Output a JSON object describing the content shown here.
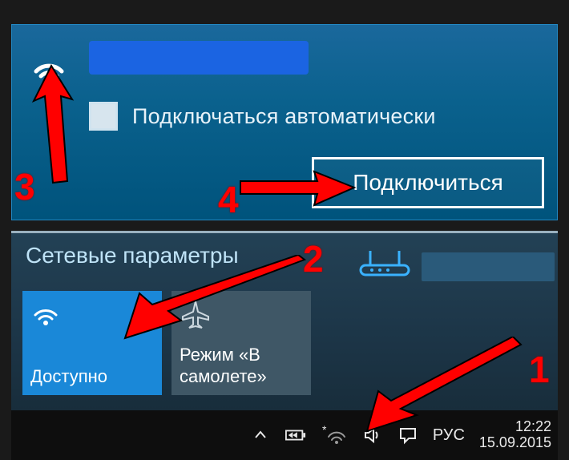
{
  "top": {
    "auto_connect_label": "Подключаться автоматически",
    "connect_button": "Подключиться"
  },
  "bottom": {
    "section_title": "Сетевые параметры",
    "tile_wifi_label": "Доступно",
    "tile_plane_label": "Режим «В самолете»"
  },
  "taskbar": {
    "lang": "РУС",
    "clock_time": "12:22",
    "clock_date": "15.09.2015"
  },
  "steps": {
    "s1": "1",
    "s2": "2",
    "s3": "3",
    "s4": "4"
  }
}
